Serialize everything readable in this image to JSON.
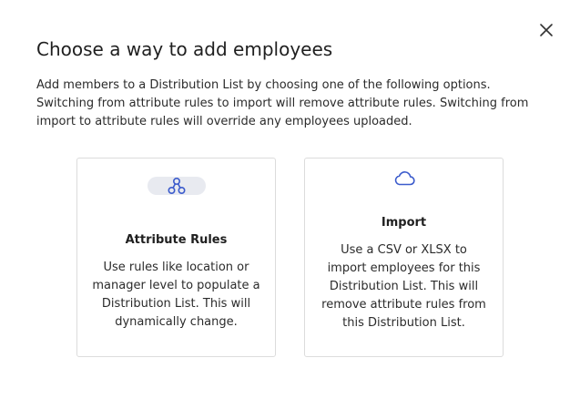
{
  "dialog": {
    "title": "Choose a way to add employees",
    "description": "Add members to a Distribution List by choosing one of the following options. Switching from attribute rules to import will remove attribute rules. Switching from import to attribute rules will override any employees uploaded.",
    "close_icon": "close-icon"
  },
  "options": [
    {
      "icon": "attribute-rules-icon",
      "title": "Attribute Rules",
      "body": "Use rules like location or manager level to populate a Distribution List. This will dynamically change."
    },
    {
      "icon": "cloud-icon",
      "title": "Import",
      "body": "Use a CSV or XLSX to import employees for this Distribution List. This will remove attribute rules from this Distribution List."
    }
  ],
  "colors": {
    "accent": "#3b5bcc",
    "card_border": "#dcdcdc",
    "icon_pill_bg": "#e8eaf0"
  }
}
